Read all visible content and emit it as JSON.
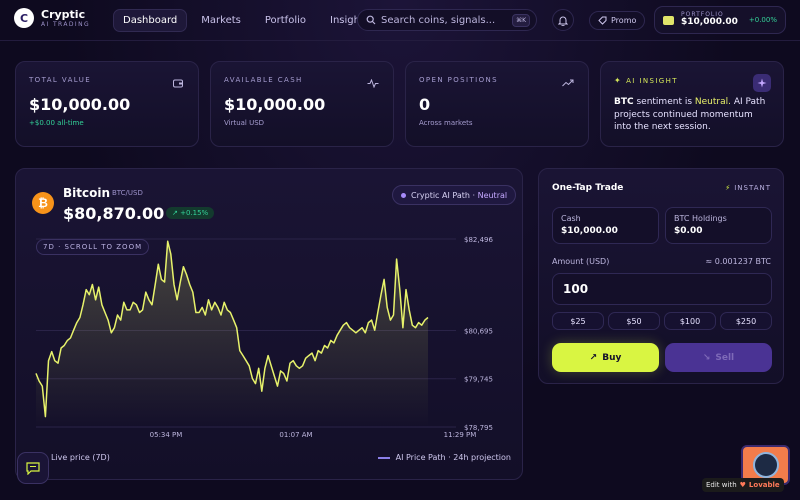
{
  "app": {
    "name": "Cryptic",
    "tagline": "AI TRADING",
    "logo_letter": "C"
  },
  "nav": [
    {
      "label": "Dashboard",
      "active": true
    },
    {
      "label": "Markets",
      "active": false
    },
    {
      "label": "Portfolio",
      "active": false
    },
    {
      "label": "Insights",
      "active": false
    }
  ],
  "search": {
    "placeholder": "Search coins, signals...",
    "shortcut": "⌘K"
  },
  "promo": {
    "label": "Promo"
  },
  "portfolio": {
    "label": "PORTFOLIO",
    "value": "$10,000.00",
    "change": "+0.00%"
  },
  "stats": [
    {
      "label": "TOTAL VALUE",
      "value": "$10,000.00",
      "sub": "+$0.00 all-time",
      "icon": "wallet-icon"
    },
    {
      "label": "AVAILABLE CASH",
      "value": "$10,000.00",
      "sub": "Virtual USD",
      "icon": "activity-icon"
    },
    {
      "label": "OPEN POSITIONS",
      "value": "0",
      "sub": "Across markets",
      "icon": "trending-up-icon"
    }
  ],
  "insight": {
    "label": "AI INSIGHT",
    "coin": "BTC",
    "text_1": " sentiment is ",
    "sentiment": "Neutral.",
    "text_2": " AI Path projects continued momentum into the next session."
  },
  "coin": {
    "name": "Bitcoin",
    "pair": "BTC/USD",
    "price": "$80,870.00",
    "change": "↗ +0.15%",
    "symbol": "₿"
  },
  "ai_path_tag": {
    "label": "Cryptic AI Path · ",
    "sentiment": "Neutral"
  },
  "zoom_tag": "7D · SCROLL TO ZOOM",
  "chart_data": {
    "type": "line",
    "series": [
      {
        "name": "Live price (7D)",
        "color": "#e7f26b",
        "values": [
          79850,
          79700,
          79600,
          79000,
          80100,
          80280,
          80100,
          80050,
          80350,
          80400,
          80500,
          80550,
          80700,
          80850,
          80950,
          81200,
          81500,
          81400,
          81600,
          81300,
          81550,
          81200,
          81050,
          80900,
          80650,
          80750,
          81000,
          80900,
          81250,
          81100,
          81100,
          81250,
          81200,
          81050,
          81100,
          81450,
          81300,
          81200,
          81600,
          82000,
          81700,
          81650,
          82450,
          82200,
          81600,
          81300,
          81650,
          81950,
          81800,
          81600,
          81450,
          81050,
          81050,
          81150,
          81000,
          81300,
          81100,
          81250,
          81150,
          81000,
          81250,
          81100,
          81050,
          80900,
          80750,
          80300,
          80200,
          80100,
          80000,
          79750,
          79650,
          79950,
          79500,
          79950,
          80200,
          80000,
          79800,
          79600,
          79900,
          79850,
          79700,
          80050,
          80100,
          80000,
          79950,
          80000,
          80150,
          80200,
          80250,
          80100,
          80300,
          80250,
          80400,
          80350,
          80500,
          80450,
          80600,
          80700,
          80800,
          80850,
          80750,
          80700,
          80650,
          80700,
          80750,
          80650,
          80850,
          80900,
          80700,
          81050,
          81400,
          81700,
          81150,
          80900,
          81000,
          82100,
          81500,
          80750,
          81500,
          81100,
          80800,
          80750,
          80850,
          80800,
          80900,
          80950
        ]
      }
    ],
    "x_tick_labels": [
      "05:34 PM",
      "01:07 AM",
      "11:29 PM"
    ],
    "y_tick_labels": [
      "$82,496",
      "$80,695",
      "$79,745",
      "$78,795"
    ],
    "ylim": [
      78795,
      82496
    ],
    "legend": [
      {
        "label": "Live price (7D)",
        "style": "solid"
      },
      {
        "label": "AI Price Path · 24h projection",
        "style": "dashed"
      }
    ]
  },
  "trade": {
    "title": "One-Tap Trade",
    "instant": "INSTANT",
    "cash_label": "Cash",
    "cash_value": "$10,000.00",
    "holdings_label": "BTC Holdings",
    "holdings_value": "$0.00",
    "amount_label": "Amount (USD)",
    "amount_conversion": "≈ 0.001237 BTC",
    "amount_value": "100",
    "quick_amounts": [
      "$25",
      "$50",
      "$100",
      "$250"
    ],
    "buy_label": "Buy",
    "sell_label": "Sell"
  },
  "badge": {
    "prefix": "Edit with",
    "brand": "Lovable"
  },
  "colors": {
    "accent": "#d9f542",
    "positive": "#34d399",
    "purple": "#a78bfa",
    "background": "#0e0a1f"
  }
}
